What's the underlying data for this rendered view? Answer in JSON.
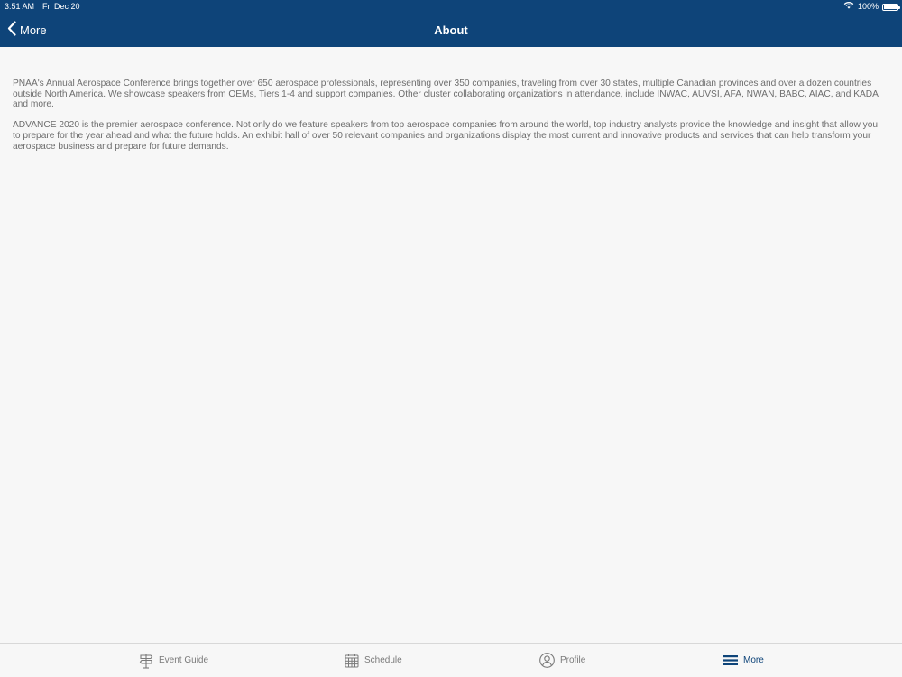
{
  "status_bar": {
    "time": "3:51 AM",
    "date": "Fri Dec 20",
    "battery": "100%",
    "battery_level": 1.0
  },
  "nav": {
    "back_label": "More",
    "title": "About"
  },
  "content": {
    "paragraphs": [
      "PNAA's Annual Aerospace Conference brings together over 650 aerospace professionals, representing over 350 companies, traveling from over 30 states, multiple Canadian provinces and over a dozen countries outside North America. We showcase speakers from OEMs, Tiers 1-4 and support companies. Other cluster collaborating organizations in attendance, include INWAC, AUVSI, AFA, NWAN, BABC, AIAC, and KADA and more.",
      "ADVANCE 2020 is the premier aerospace conference. Not only do we feature speakers from top aerospace companies from around the world, top industry analysts provide the knowledge and insight that allow you to prepare for the year ahead and what the future holds.  An exhibit hall of over 50 relevant companies and organizations display the most current and innovative products and services that can help transform your aerospace business and prepare for future demands."
    ]
  },
  "tabbar": {
    "tabs": [
      {
        "label": "Event Guide",
        "icon": "signpost-icon",
        "active": false
      },
      {
        "label": "Schedule",
        "icon": "calendar-icon",
        "active": false
      },
      {
        "label": "Profile",
        "icon": "profile-icon",
        "active": false
      },
      {
        "label": "More",
        "icon": "menu-icon",
        "active": true
      }
    ]
  },
  "colors": {
    "header_bg": "#0e4479",
    "page_bg": "#f7f7f7",
    "body_text": "#6d6d6d",
    "tab_inactive": "#7a7a7a",
    "tab_active": "#0e4479"
  }
}
